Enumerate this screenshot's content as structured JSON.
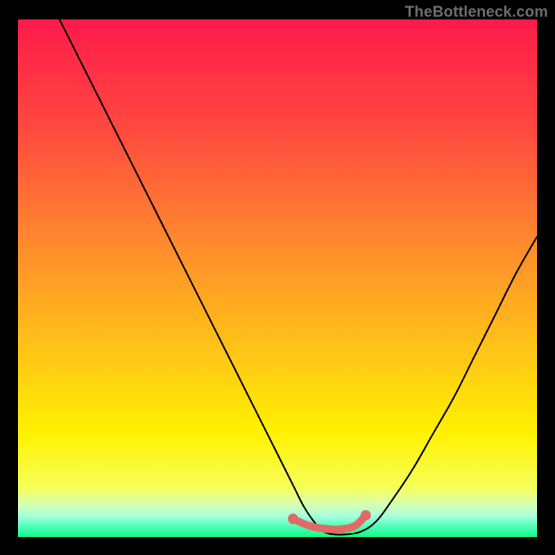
{
  "attribution": "TheBottleneck.com",
  "colors": {
    "frame": "#000000",
    "attribution_text": "#6f6f6f",
    "curve": "#000000",
    "valley_marker": "#e16a67",
    "gradient_stops": [
      {
        "offset": 0.0,
        "color": "#ff1a4a"
      },
      {
        "offset": 0.22,
        "color": "#ff4b3f"
      },
      {
        "offset": 0.45,
        "color": "#ff8f2b"
      },
      {
        "offset": 0.65,
        "color": "#ffc716"
      },
      {
        "offset": 0.8,
        "color": "#fff200"
      },
      {
        "offset": 0.905,
        "color": "#f6ff5a"
      },
      {
        "offset": 0.935,
        "color": "#d9ffb0"
      },
      {
        "offset": 0.96,
        "color": "#a6ffde"
      },
      {
        "offset": 0.985,
        "color": "#3affae"
      },
      {
        "offset": 1.0,
        "color": "#17f983"
      }
    ]
  },
  "chart_data": {
    "type": "line",
    "title": "",
    "xlabel": "",
    "ylabel": "",
    "xlim": [
      0,
      100
    ],
    "ylim": [
      0,
      100
    ],
    "series": [
      {
        "name": "bottleneck-curve",
        "x": [
          8,
          10,
          14,
          18,
          22,
          26,
          30,
          34,
          38,
          42,
          46,
          50,
          53,
          55,
          57,
          59,
          61,
          63,
          66,
          69,
          72,
          76,
          80,
          84,
          88,
          92,
          96,
          100
        ],
        "y": [
          100,
          96,
          88,
          80,
          72,
          64,
          56,
          48,
          40,
          32,
          24,
          16,
          10,
          6,
          3,
          1,
          0.5,
          0.5,
          1,
          3,
          7,
          13,
          20,
          27,
          35,
          43,
          51,
          58
        ]
      },
      {
        "name": "valley-marker",
        "x": [
          53,
          56,
          59,
          62,
          65,
          67
        ],
        "y": [
          3.5,
          2.2,
          1.6,
          1.5,
          2.2,
          4.2
        ]
      }
    ]
  }
}
